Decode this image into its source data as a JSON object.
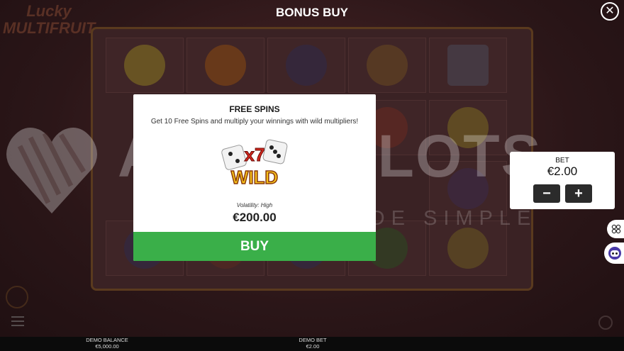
{
  "header": {
    "title": "BONUS BUY",
    "close_icon": "close-icon"
  },
  "game": {
    "logo_text": "Lucky MULTIFRUIT"
  },
  "watermark": {
    "text": "ABOUTSLOTS",
    "subtext": "GAMBLING MADE SIMPLE"
  },
  "modal": {
    "title": "FREE SPINS",
    "description": "Get 10 Free Spins and multiply your winnings with wild multipliers!",
    "feature_multiplier": "x7",
    "feature_label": "WILD",
    "volatility": "Volatility: High",
    "price": "€200.00",
    "buy_label": "BUY"
  },
  "bet_panel": {
    "label": "BET",
    "value": "€2.00",
    "minus": "−",
    "plus": "+"
  },
  "footer": {
    "balance_label": "DEMO BALANCE",
    "balance_value": "€5,000.00",
    "bet_label": "DEMO BET",
    "bet_value": "€2.00"
  },
  "colors": {
    "buy_green": "#3aaf49",
    "bet_button": "#2b2b2b"
  }
}
